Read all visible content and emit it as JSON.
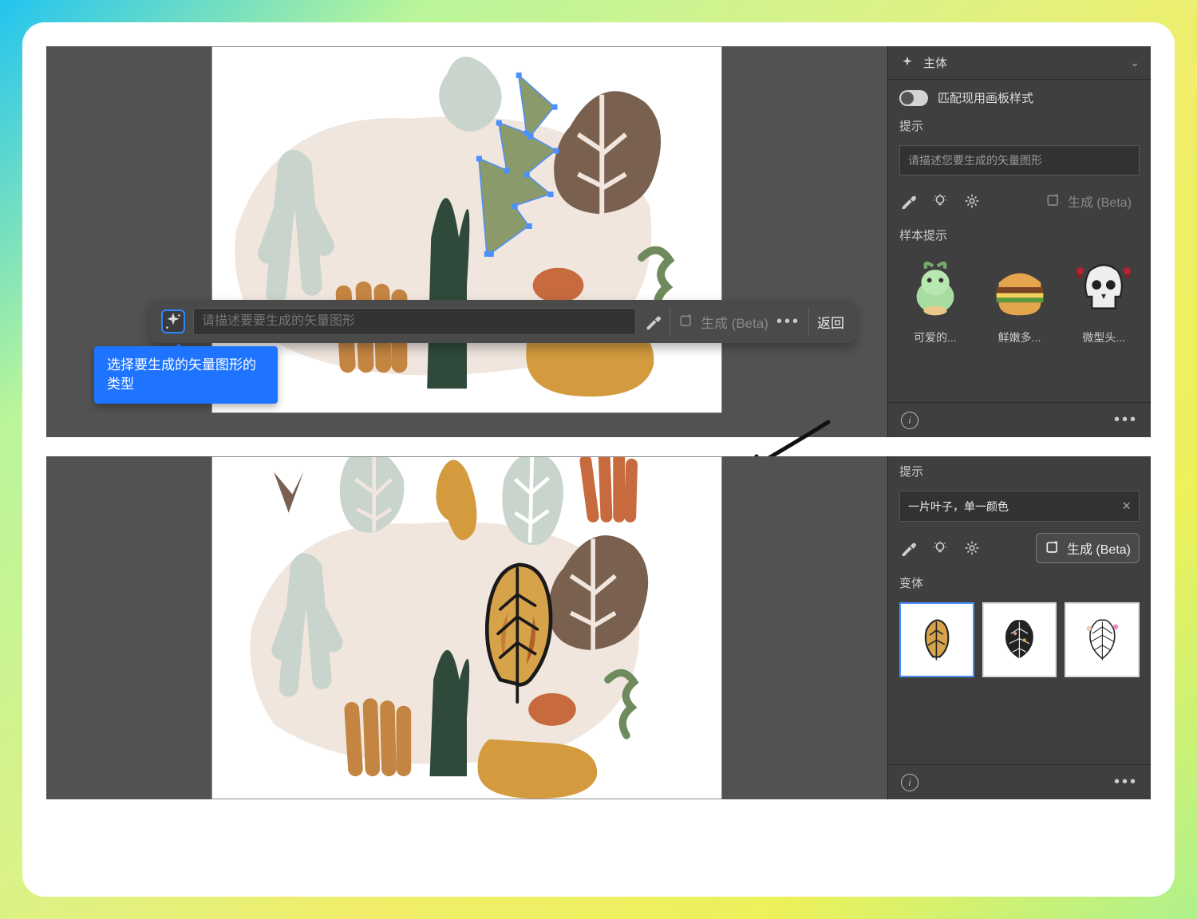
{
  "top": {
    "panel_header": "主体",
    "match_style_label": "匹配现用画板样式",
    "prompt_section_title": "提示",
    "prompt_placeholder": "请描述您要生成的矢量图形",
    "generate_label": "生成 (Beta)",
    "samples_section_title": "样本提示",
    "samples": [
      {
        "label": "可爱的..."
      },
      {
        "label": "鲜嫩多..."
      },
      {
        "label": "微型头..."
      }
    ],
    "prompt_bar": {
      "placeholder": "请描述要要生成的矢量图形",
      "generate_label": "生成 (Beta)",
      "back_label": "返回"
    },
    "tooltip": "选择要生成的矢量图形的类型"
  },
  "bottom": {
    "prompt_section_title": "提示",
    "prompt_value": "一片叶子，单一颜色",
    "generate_label": "生成 (Beta)",
    "variants_section_title": "变体"
  },
  "colors": {
    "accent_blue": "#1f74ff",
    "panel_bg": "#3f3f3f",
    "canvas_bg": "#525252"
  }
}
